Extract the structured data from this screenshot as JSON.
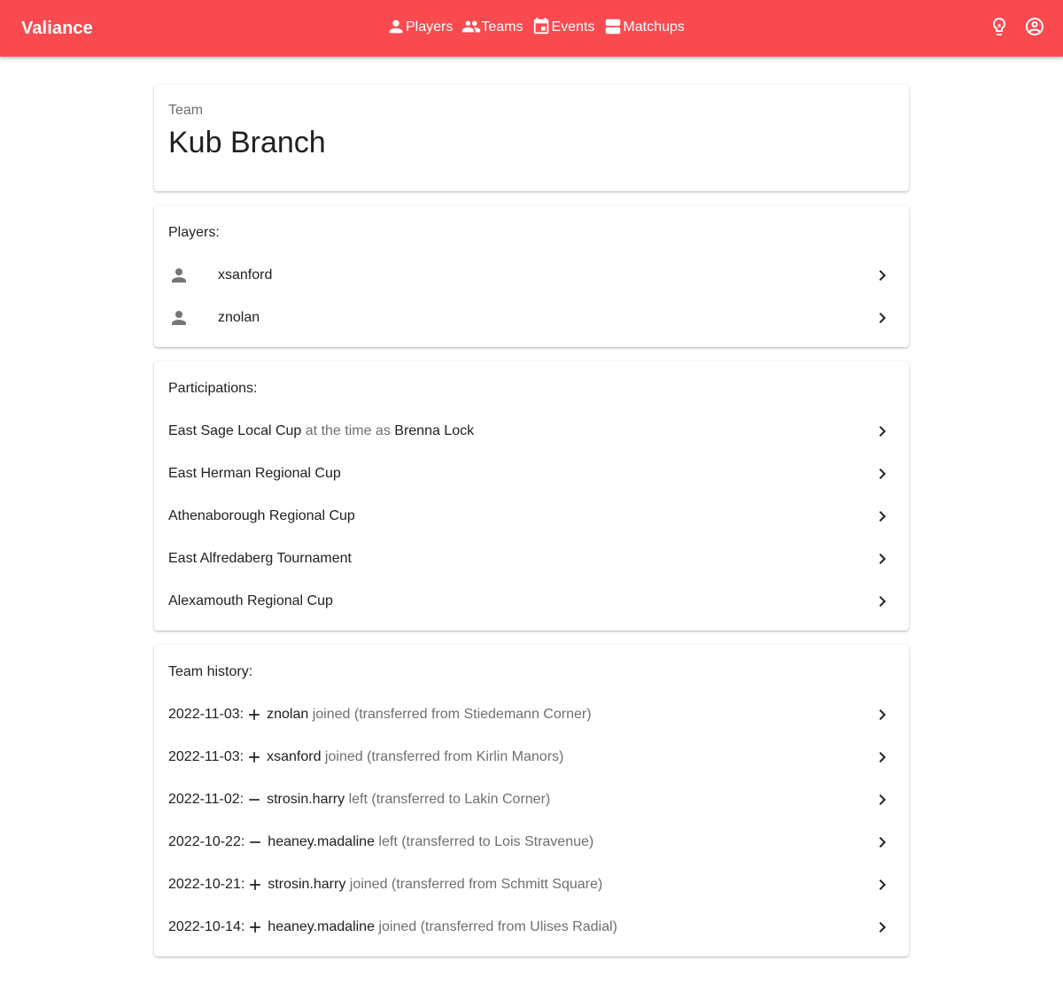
{
  "app": {
    "brand": "Valiance"
  },
  "nav": [
    {
      "label": "Players",
      "icon": "person-icon"
    },
    {
      "label": "Teams",
      "icon": "people-icon"
    },
    {
      "label": "Events",
      "icon": "calendar-icon"
    },
    {
      "label": "Matchups",
      "icon": "matchups-icon"
    }
  ],
  "actions": [
    {
      "icon": "lightbulb-icon"
    },
    {
      "icon": "account-circle-icon"
    }
  ],
  "team": {
    "overline": "Team",
    "name": "Kub Branch"
  },
  "players": {
    "title": "Players:",
    "items": [
      {
        "name": "xsanford"
      },
      {
        "name": "znolan"
      }
    ]
  },
  "participations": {
    "title": "Participations:",
    "items": [
      {
        "event": "East Sage Local Cup",
        "note": " at the time as ",
        "team": "Brenna Lock"
      },
      {
        "event": "East Herman Regional Cup",
        "note": "",
        "team": ""
      },
      {
        "event": "Athenaborough Regional Cup",
        "note": "",
        "team": ""
      },
      {
        "event": "East Alfredaberg Tournament",
        "note": "",
        "team": ""
      },
      {
        "event": "Alexamouth Regional Cup",
        "note": "",
        "team": ""
      }
    ]
  },
  "history": {
    "title": "Team history:",
    "items": [
      {
        "date": "2022-11-03:",
        "sign": "plus",
        "player": "znolan",
        "text": " joined (transferred from Stiedemann Corner)"
      },
      {
        "date": "2022-11-03:",
        "sign": "plus",
        "player": "xsanford",
        "text": " joined (transferred from Kirlin Manors)"
      },
      {
        "date": "2022-11-02:",
        "sign": "minus",
        "player": "strosin.harry",
        "text": " left (transferred to Lakin Corner)"
      },
      {
        "date": "2022-10-22:",
        "sign": "minus",
        "player": "heaney.madaline",
        "text": " left (transferred to Lois Stravenue)"
      },
      {
        "date": "2022-10-21:",
        "sign": "plus",
        "player": "strosin.harry",
        "text": " joined (transferred from Schmitt Square)"
      },
      {
        "date": "2022-10-14:",
        "sign": "plus",
        "player": "heaney.madaline",
        "text": " joined (transferred from Ulises Radial)"
      }
    ]
  },
  "colors": {
    "appbar": "#f94a50",
    "muted": "#6f6f6f"
  }
}
